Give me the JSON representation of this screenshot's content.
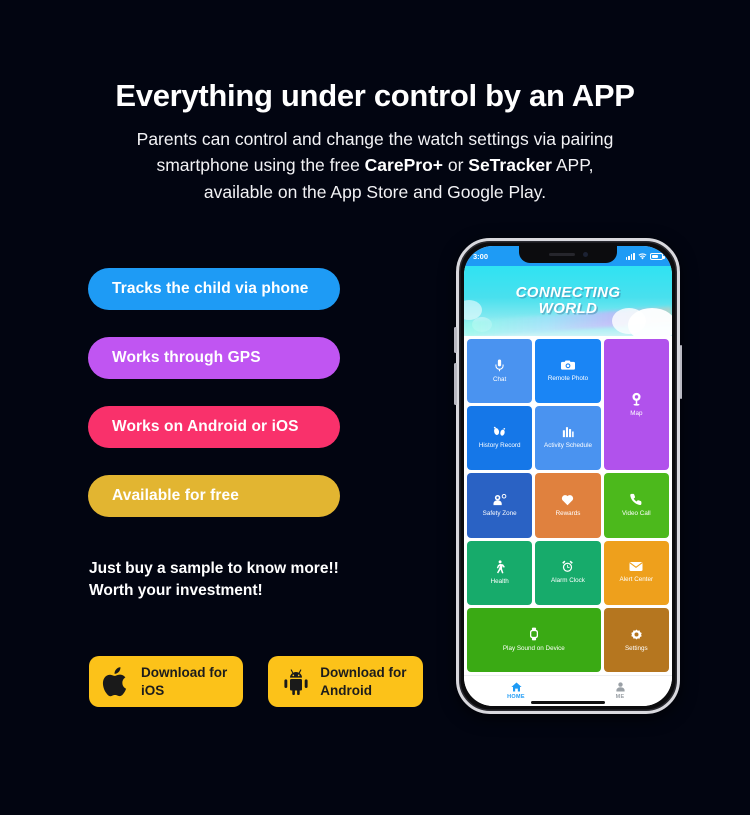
{
  "header": {
    "headline": "Everything under control by an APP",
    "subcopy_line1_a": "Parents can control and change the watch settings via pairing",
    "subcopy_line2_a": "smartphone using the free ",
    "subcopy_brand1": "CarePro+",
    "subcopy_line2_b": " or ",
    "subcopy_brand2": "SeTracker",
    "subcopy_line2_c": " APP,",
    "subcopy_line3": "available on the App Store and Google Play."
  },
  "features": [
    {
      "label": "Tracks the child via phone",
      "color": "#1e9bf5"
    },
    {
      "label": "Works through GPS",
      "color": "#c055f2"
    },
    {
      "label": "Works on Android or iOS",
      "color": "#f9316b"
    },
    {
      "label": "Available for free",
      "color": "#e2b531"
    }
  ],
  "tagline": {
    "line1": "Just buy a sample to know more!!",
    "line2": "Worth your investment!"
  },
  "stores": {
    "accent": "#fcc219",
    "ios": {
      "label": "Download for\niOS",
      "icon": "apple-icon"
    },
    "android": {
      "label": "Download for\nAndroid",
      "icon": "android-icon"
    }
  },
  "phone": {
    "status": {
      "time": "3:00",
      "signal_icon": "cellular-signal-icon",
      "wifi_icon": "wifi-icon",
      "battery_icon": "battery-icon"
    },
    "banner": {
      "title_line1": "CONNECTING",
      "title_line2": "WORLD"
    },
    "tiles": [
      {
        "label": "Chat",
        "icon": "microphone-icon",
        "color": "#4a93f0"
      },
      {
        "label": "Remote Photo",
        "icon": "camera-icon",
        "color": "#1a85f5"
      },
      {
        "label": "Map",
        "icon": "location-pin-icon",
        "color": "#b152ec"
      },
      {
        "label": "History\nRecord",
        "icon": "footsteps-icon",
        "color": "#1577e8"
      },
      {
        "label": "Activity\nSchedule",
        "icon": "bar-chart-icon",
        "color": "#4a93f0"
      },
      {
        "label": "Safety Zone",
        "icon": "geofence-icon",
        "color": "#2a62c4"
      },
      {
        "label": "Rewards",
        "icon": "heart-icon",
        "color": "#e0813e"
      },
      {
        "label": "Video Call",
        "icon": "phone-call-icon",
        "color": "#4cb91c"
      },
      {
        "label": "Health",
        "icon": "walking-person-icon",
        "color": "#17ab6b"
      },
      {
        "label": "Alarm Clock",
        "icon": "alarm-clock-icon",
        "color": "#17ab6b"
      },
      {
        "label": "Alert Center",
        "icon": "envelope-icon",
        "color": "#eea01c"
      },
      {
        "label": "Play Sound on Device",
        "icon": "smartwatch-icon",
        "color": "#3aaa14"
      },
      {
        "label": "Settings",
        "icon": "gear-icon",
        "color": "#b5761f"
      }
    ],
    "tabs": [
      {
        "label": "HOME",
        "icon": "home-icon",
        "active": true,
        "color": "#1e9bf5"
      },
      {
        "label": "ME",
        "icon": "person-icon",
        "active": false,
        "color": "#9aa0a6"
      }
    ]
  }
}
